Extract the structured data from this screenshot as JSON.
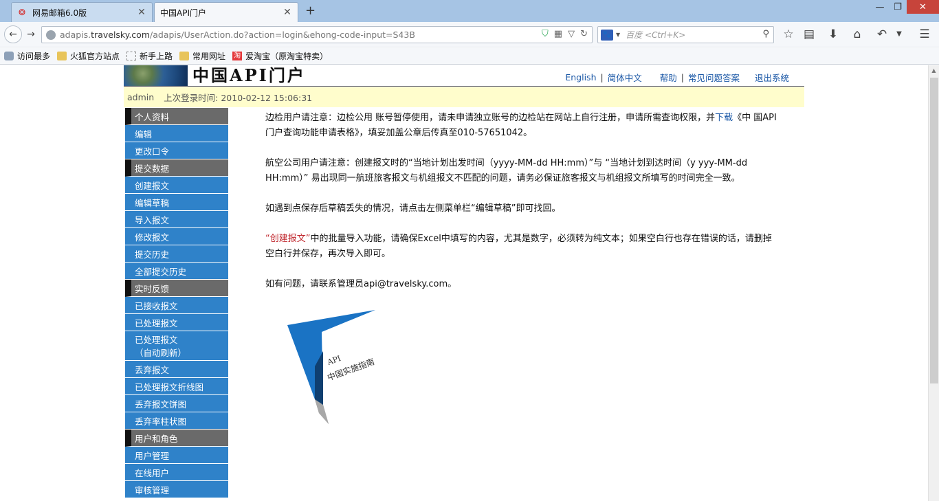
{
  "browser": {
    "tabs": [
      {
        "title": "网易邮箱6.0版",
        "favicon": "netease-mail-icon"
      },
      {
        "title": "中国API门户",
        "favicon": "none"
      }
    ],
    "url_host": "adapis.travelsky.com",
    "url_prefix": "adapis.",
    "url_domain": "travelsky.com",
    "url_path": "/adapis/UserAction.do?action=login&ehong-code-input=S43B",
    "search_placeholder": "百度 <Ctrl+K>",
    "bookmarks": [
      {
        "label": "访问最多"
      },
      {
        "label": "火狐官方站点"
      },
      {
        "label": "新手上路"
      },
      {
        "label": "常用网址"
      },
      {
        "label": "爱淘宝（原淘宝特卖）"
      }
    ]
  },
  "site": {
    "title": "中国API门户",
    "toplinks": {
      "english": "English",
      "chinese": "简体中文",
      "help": "帮助",
      "faq": "常见问题答案",
      "logout": "退出系统"
    },
    "user": "admin",
    "last_login_label": "上次登录时间: 2010-02-12 15:06:31"
  },
  "sidebar": [
    {
      "label": "个人资料",
      "type": "head"
    },
    {
      "label": "编辑",
      "type": "link"
    },
    {
      "label": "更改口令",
      "type": "link"
    },
    {
      "label": "提交数据",
      "type": "head"
    },
    {
      "label": "创建报文",
      "type": "link"
    },
    {
      "label": "编辑草稿",
      "type": "link"
    },
    {
      "label": "导入报文",
      "type": "link"
    },
    {
      "label": "修改报文",
      "type": "link"
    },
    {
      "label": "提交历史",
      "type": "link"
    },
    {
      "label": "全部提交历史",
      "type": "link"
    },
    {
      "label": "实时反馈",
      "type": "head"
    },
    {
      "label": "已接收报文",
      "type": "link"
    },
    {
      "label": "已处理报文",
      "type": "link"
    },
    {
      "label": "已处理报文",
      "sub": "（自动刷新）",
      "type": "link"
    },
    {
      "label": "丢弃报文",
      "type": "link"
    },
    {
      "label": "已处理报文折线图",
      "type": "link"
    },
    {
      "label": "丢弃报文饼图",
      "type": "link"
    },
    {
      "label": "丢弃率柱状图",
      "type": "link"
    },
    {
      "label": "用户和角色",
      "type": "head"
    },
    {
      "label": "用户管理",
      "type": "link"
    },
    {
      "label": "在线用户",
      "type": "link"
    },
    {
      "label": "审核管理",
      "type": "link"
    }
  ],
  "content": {
    "p1_a": "边检用户请注意：边检公用 账号暂停使用，请未申请独立账号的边检站在网站上自行注册，申请所需查询权限，并",
    "p1_link": "下载",
    "p1_b": "《中 国API门户查询功能申请表格》，填妥加盖公章后传真至010-57651042。",
    "p2": "航空公司用户请注意：创建报文时的“当地计划出发时间（yyyy-MM-dd HH:mm）”与 “当地计划到达时间（y yyy-MM-dd HH:mm）” 易出现同一航班旅客报文与机组报文不匹配的问题，请务必保证旅客报文与机组报文所填写的时间完全一致。",
    "p3": "如遇到点保存后草稿丢失的情况，请点击左侧菜单栏“编辑草稿”即可找回。",
    "p4_red": "“创建报文”",
    "p4_rest": "中的批量导入功能，请确保Excel中填写的内容，尤其是数字，必须转为纯文本；如果空白行也存在错误的话，请删掉空白行并保存，再次导入即可。",
    "p5": "如有问题，请联系管理员api@travelsky.com。"
  },
  "guide_image": {
    "line1": "API",
    "line2": "中国实施指南"
  },
  "colors": {
    "sidebar_link": "#2f82c9",
    "sidebar_head": "#6a6a6a",
    "userbar": "#fffdcc",
    "link": "#1a57a6",
    "red": "#c0272d"
  }
}
